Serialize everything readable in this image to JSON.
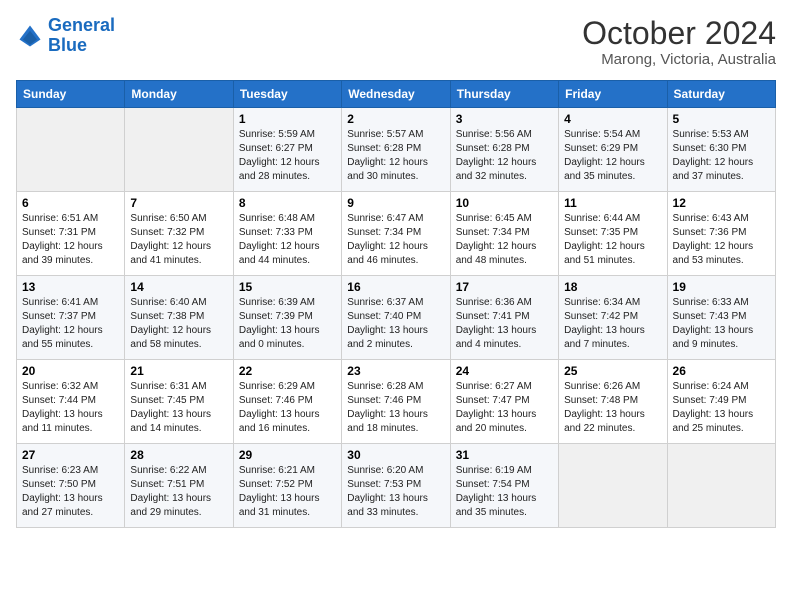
{
  "header": {
    "logo_line1": "General",
    "logo_line2": "Blue",
    "month_year": "October 2024",
    "location": "Marong, Victoria, Australia"
  },
  "weekdays": [
    "Sunday",
    "Monday",
    "Tuesday",
    "Wednesday",
    "Thursday",
    "Friday",
    "Saturday"
  ],
  "weeks": [
    [
      {
        "day": "",
        "sunrise": "",
        "sunset": "",
        "daylight": ""
      },
      {
        "day": "",
        "sunrise": "",
        "sunset": "",
        "daylight": ""
      },
      {
        "day": "1",
        "sunrise": "Sunrise: 5:59 AM",
        "sunset": "Sunset: 6:27 PM",
        "daylight": "Daylight: 12 hours and 28 minutes."
      },
      {
        "day": "2",
        "sunrise": "Sunrise: 5:57 AM",
        "sunset": "Sunset: 6:28 PM",
        "daylight": "Daylight: 12 hours and 30 minutes."
      },
      {
        "day": "3",
        "sunrise": "Sunrise: 5:56 AM",
        "sunset": "Sunset: 6:28 PM",
        "daylight": "Daylight: 12 hours and 32 minutes."
      },
      {
        "day": "4",
        "sunrise": "Sunrise: 5:54 AM",
        "sunset": "Sunset: 6:29 PM",
        "daylight": "Daylight: 12 hours and 35 minutes."
      },
      {
        "day": "5",
        "sunrise": "Sunrise: 5:53 AM",
        "sunset": "Sunset: 6:30 PM",
        "daylight": "Daylight: 12 hours and 37 minutes."
      }
    ],
    [
      {
        "day": "6",
        "sunrise": "Sunrise: 6:51 AM",
        "sunset": "Sunset: 7:31 PM",
        "daylight": "Daylight: 12 hours and 39 minutes."
      },
      {
        "day": "7",
        "sunrise": "Sunrise: 6:50 AM",
        "sunset": "Sunset: 7:32 PM",
        "daylight": "Daylight: 12 hours and 41 minutes."
      },
      {
        "day": "8",
        "sunrise": "Sunrise: 6:48 AM",
        "sunset": "Sunset: 7:33 PM",
        "daylight": "Daylight: 12 hours and 44 minutes."
      },
      {
        "day": "9",
        "sunrise": "Sunrise: 6:47 AM",
        "sunset": "Sunset: 7:34 PM",
        "daylight": "Daylight: 12 hours and 46 minutes."
      },
      {
        "day": "10",
        "sunrise": "Sunrise: 6:45 AM",
        "sunset": "Sunset: 7:34 PM",
        "daylight": "Daylight: 12 hours and 48 minutes."
      },
      {
        "day": "11",
        "sunrise": "Sunrise: 6:44 AM",
        "sunset": "Sunset: 7:35 PM",
        "daylight": "Daylight: 12 hours and 51 minutes."
      },
      {
        "day": "12",
        "sunrise": "Sunrise: 6:43 AM",
        "sunset": "Sunset: 7:36 PM",
        "daylight": "Daylight: 12 hours and 53 minutes."
      }
    ],
    [
      {
        "day": "13",
        "sunrise": "Sunrise: 6:41 AM",
        "sunset": "Sunset: 7:37 PM",
        "daylight": "Daylight: 12 hours and 55 minutes."
      },
      {
        "day": "14",
        "sunrise": "Sunrise: 6:40 AM",
        "sunset": "Sunset: 7:38 PM",
        "daylight": "Daylight: 12 hours and 58 minutes."
      },
      {
        "day": "15",
        "sunrise": "Sunrise: 6:39 AM",
        "sunset": "Sunset: 7:39 PM",
        "daylight": "Daylight: 13 hours and 0 minutes."
      },
      {
        "day": "16",
        "sunrise": "Sunrise: 6:37 AM",
        "sunset": "Sunset: 7:40 PM",
        "daylight": "Daylight: 13 hours and 2 minutes."
      },
      {
        "day": "17",
        "sunrise": "Sunrise: 6:36 AM",
        "sunset": "Sunset: 7:41 PM",
        "daylight": "Daylight: 13 hours and 4 minutes."
      },
      {
        "day": "18",
        "sunrise": "Sunrise: 6:34 AM",
        "sunset": "Sunset: 7:42 PM",
        "daylight": "Daylight: 13 hours and 7 minutes."
      },
      {
        "day": "19",
        "sunrise": "Sunrise: 6:33 AM",
        "sunset": "Sunset: 7:43 PM",
        "daylight": "Daylight: 13 hours and 9 minutes."
      }
    ],
    [
      {
        "day": "20",
        "sunrise": "Sunrise: 6:32 AM",
        "sunset": "Sunset: 7:44 PM",
        "daylight": "Daylight: 13 hours and 11 minutes."
      },
      {
        "day": "21",
        "sunrise": "Sunrise: 6:31 AM",
        "sunset": "Sunset: 7:45 PM",
        "daylight": "Daylight: 13 hours and 14 minutes."
      },
      {
        "day": "22",
        "sunrise": "Sunrise: 6:29 AM",
        "sunset": "Sunset: 7:46 PM",
        "daylight": "Daylight: 13 hours and 16 minutes."
      },
      {
        "day": "23",
        "sunrise": "Sunrise: 6:28 AM",
        "sunset": "Sunset: 7:46 PM",
        "daylight": "Daylight: 13 hours and 18 minutes."
      },
      {
        "day": "24",
        "sunrise": "Sunrise: 6:27 AM",
        "sunset": "Sunset: 7:47 PM",
        "daylight": "Daylight: 13 hours and 20 minutes."
      },
      {
        "day": "25",
        "sunrise": "Sunrise: 6:26 AM",
        "sunset": "Sunset: 7:48 PM",
        "daylight": "Daylight: 13 hours and 22 minutes."
      },
      {
        "day": "26",
        "sunrise": "Sunrise: 6:24 AM",
        "sunset": "Sunset: 7:49 PM",
        "daylight": "Daylight: 13 hours and 25 minutes."
      }
    ],
    [
      {
        "day": "27",
        "sunrise": "Sunrise: 6:23 AM",
        "sunset": "Sunset: 7:50 PM",
        "daylight": "Daylight: 13 hours and 27 minutes."
      },
      {
        "day": "28",
        "sunrise": "Sunrise: 6:22 AM",
        "sunset": "Sunset: 7:51 PM",
        "daylight": "Daylight: 13 hours and 29 minutes."
      },
      {
        "day": "29",
        "sunrise": "Sunrise: 6:21 AM",
        "sunset": "Sunset: 7:52 PM",
        "daylight": "Daylight: 13 hours and 31 minutes."
      },
      {
        "day": "30",
        "sunrise": "Sunrise: 6:20 AM",
        "sunset": "Sunset: 7:53 PM",
        "daylight": "Daylight: 13 hours and 33 minutes."
      },
      {
        "day": "31",
        "sunrise": "Sunrise: 6:19 AM",
        "sunset": "Sunset: 7:54 PM",
        "daylight": "Daylight: 13 hours and 35 minutes."
      },
      {
        "day": "",
        "sunrise": "",
        "sunset": "",
        "daylight": ""
      },
      {
        "day": "",
        "sunrise": "",
        "sunset": "",
        "daylight": ""
      }
    ]
  ]
}
